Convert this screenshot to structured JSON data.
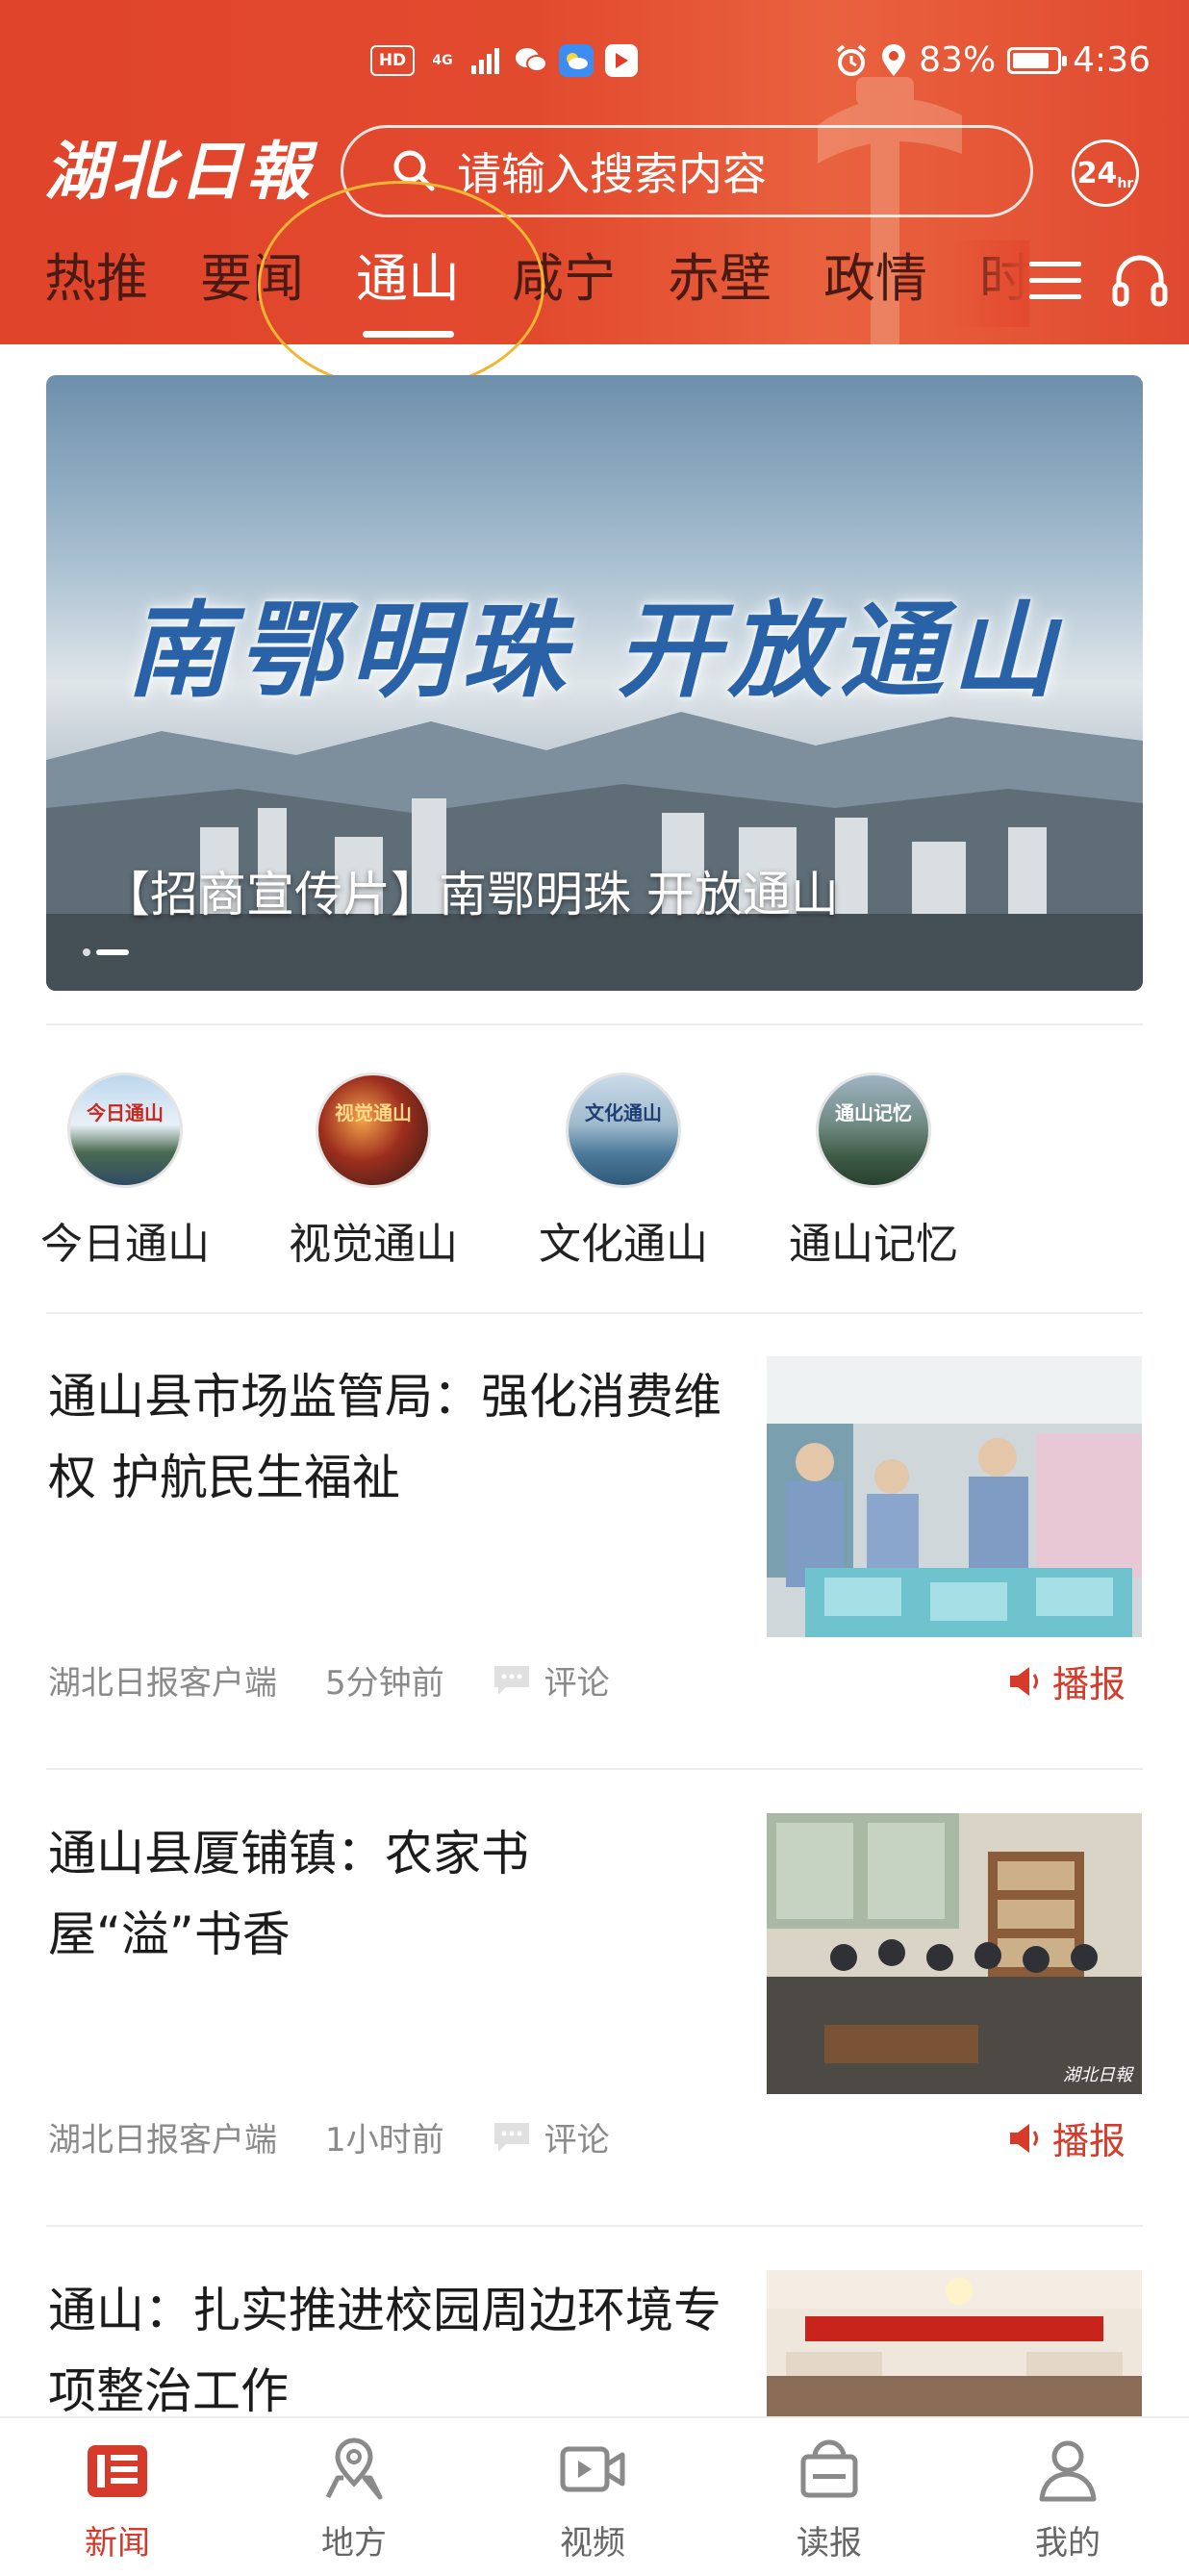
{
  "status_bar": {
    "left_icons": [
      "HD",
      "4G",
      "signal-icon",
      "wechat-icon",
      "weather-icon",
      "play-icon"
    ],
    "hd_label": "HD",
    "network_label": "4G",
    "battery_percent": "83%",
    "battery_level": 0.83,
    "time": "4:36"
  },
  "header": {
    "logo_text": "湖北日報",
    "search_placeholder": "请输入搜索内容",
    "badge_24": "24",
    "badge_24_sub": "hr",
    "colors": {
      "primary": "#e24a2e",
      "tab_text": "#4a1b14",
      "highlight_ring": "#f2b632"
    }
  },
  "tabs": [
    {
      "label": "热推",
      "active": false
    },
    {
      "label": "要闻",
      "active": false
    },
    {
      "label": "通山",
      "active": true
    },
    {
      "label": "咸宁",
      "active": false
    },
    {
      "label": "赤壁",
      "active": false
    },
    {
      "label": "政情",
      "active": false
    },
    {
      "label": "时",
      "active": false
    }
  ],
  "banner": {
    "art_text": "南鄂明珠 开放通山",
    "caption": "【招商宣传片】南鄂明珠 开放通山"
  },
  "shortcuts": [
    {
      "label": "今日通山",
      "icon_text": "今日通山"
    },
    {
      "label": "视觉通山",
      "icon_text": "视觉通山"
    },
    {
      "label": "文化通山",
      "icon_text": "文化通山"
    },
    {
      "label": "通山记忆",
      "icon_text": "通山记忆"
    }
  ],
  "news": [
    {
      "title": "通山县市场监管局：强化消费维权 护航民生福祉",
      "source": "湖北日报客户端",
      "time": "5分钟前",
      "comment_label": "评论",
      "broadcast_label": "播报"
    },
    {
      "title": "通山县厦铺镇：农家书屋“溢”书香",
      "source": "湖北日报客户端",
      "time": "1小时前",
      "comment_label": "评论",
      "broadcast_label": "播报",
      "thumb_watermark": "湖北日報"
    },
    {
      "title": "通山：扎实推进校园周边环境专项整治工作"
    }
  ],
  "bottom_nav": [
    {
      "label": "新闻",
      "icon": "news-icon",
      "active": true
    },
    {
      "label": "地方",
      "icon": "map-pin-icon",
      "active": false
    },
    {
      "label": "视频",
      "icon": "video-icon",
      "active": false
    },
    {
      "label": "读报",
      "icon": "newspaper-icon",
      "active": false
    },
    {
      "label": "我的",
      "icon": "user-icon",
      "active": false
    }
  ]
}
